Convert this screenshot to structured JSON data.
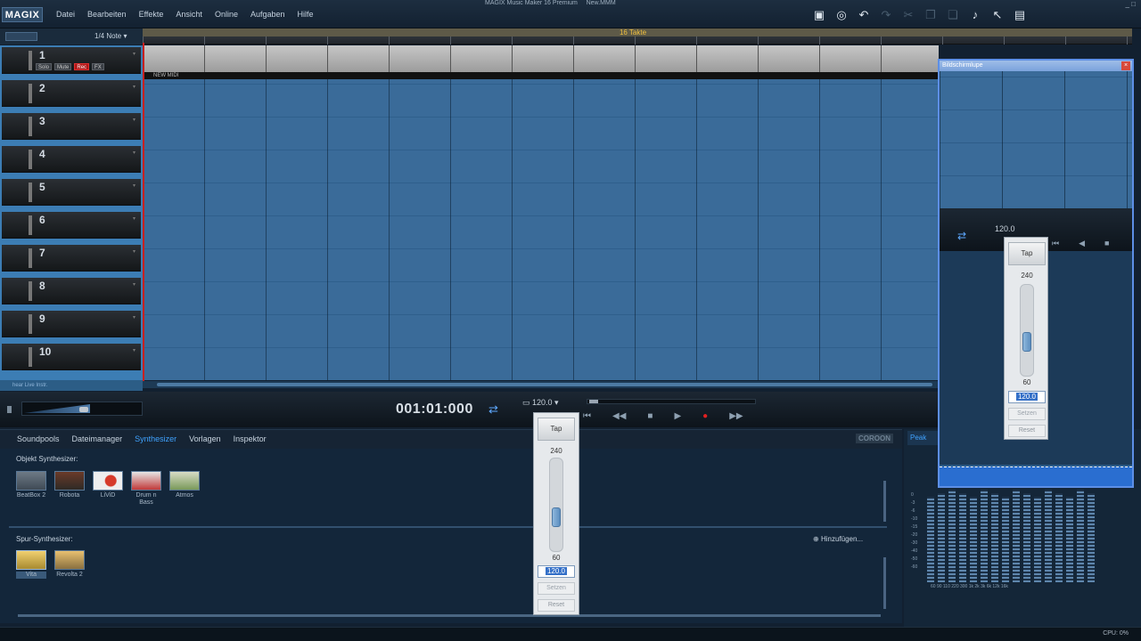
{
  "titlebar": {
    "logo": "MAGIX",
    "menu": [
      "Datei",
      "Bearbeiten",
      "Effekte",
      "Ansicht",
      "Online",
      "Aufgaben",
      "Hilfe"
    ],
    "app_title": "MAGIX Music Maker 16 Premium",
    "project": "New.MMM",
    "win_controls": "_  □"
  },
  "arranger": {
    "quantize": "1/4 Note",
    "ruler_label": "16 Takte",
    "midi_object": "NEW MIDI",
    "tracks": [
      {
        "num": "1"
      },
      {
        "num": "2"
      },
      {
        "num": "3"
      },
      {
        "num": "4"
      },
      {
        "num": "5"
      },
      {
        "num": "6"
      },
      {
        "num": "7"
      },
      {
        "num": "8"
      },
      {
        "num": "9"
      },
      {
        "num": "10"
      }
    ],
    "track1_buttons": {
      "solo": "Solo",
      "mute": "Mute",
      "rec": "Rec",
      "fx": "FX"
    },
    "footer": "hear Live Instr."
  },
  "transport": {
    "timecode": "001:01:000",
    "bpm": "120.0",
    "buttons": [
      "⏮",
      "◀◀",
      "■",
      "▶",
      "●",
      "▶▶"
    ]
  },
  "tempo_popup": {
    "tap": "Tap",
    "max": "240",
    "min": "60",
    "value": "120.0",
    "set": "Setzen",
    "reset": "Reset"
  },
  "tabs": {
    "items": [
      "Soundpools",
      "Dateimanager",
      "Synthesizer",
      "Vorlagen",
      "Inspektor"
    ],
    "active": "Synthesizer",
    "brand": "COROON"
  },
  "browser": {
    "object_synths_label": "Objekt Synthesizer:",
    "object_synths": [
      {
        "name": "BeatBox 2"
      },
      {
        "name": "Robota"
      },
      {
        "name": "LiViD"
      },
      {
        "name": "Drum n Bass"
      },
      {
        "name": "Atmos"
      }
    ],
    "track_synths_label": "Spur-Synthesizer:",
    "track_synths": [
      {
        "name": "Vita"
      },
      {
        "name": "Revolta 2"
      }
    ],
    "add_label": "Hinzufügen..."
  },
  "right_pane": {
    "tab": "Peak",
    "scale": [
      "0",
      "-3",
      "-6",
      "-10",
      "-15",
      "-20",
      "-30",
      "-40",
      "-50",
      "-60"
    ],
    "freqs": "60 90 110 220 300 1k 2k 3k 6k 12k 16k"
  },
  "magnifier": {
    "title": "Bildschirmlupe",
    "close": "×",
    "bpm": "120.0",
    "tap": "Tap",
    "max": "240",
    "min": "60",
    "value": "120.0",
    "set": "Setzen",
    "reset": "Reset"
  },
  "status": {
    "cpu": "CPU:  0%"
  },
  "colors": {
    "accent": "#3fa2ff",
    "arrange_bg": "#3b6e9c",
    "record": "#e02020"
  }
}
